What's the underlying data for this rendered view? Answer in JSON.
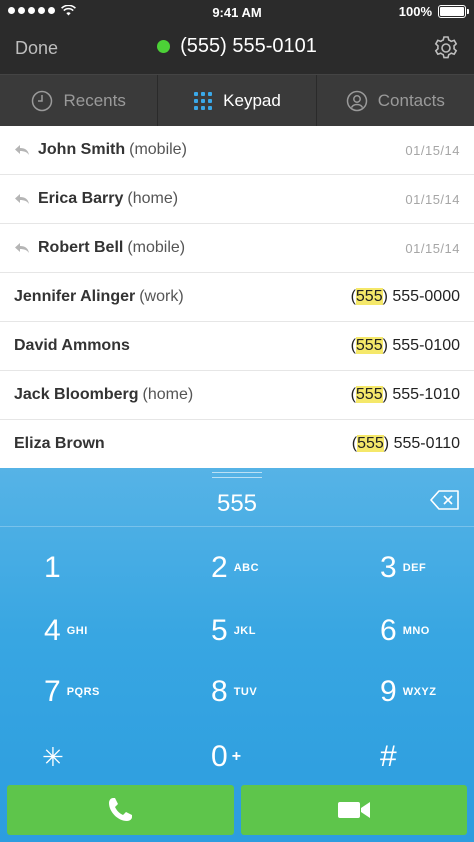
{
  "status": {
    "carrier_icon": "signal-dots",
    "time": "9:41 AM",
    "battery": "100%"
  },
  "nav": {
    "done_label": "Done",
    "call_number": "(555) 555-0101",
    "active_dot_color": "#4cd137"
  },
  "tabs": [
    {
      "label": "Recents",
      "icon": "clock-icon"
    },
    {
      "label": "Keypad",
      "icon": "keypad-grid-icon",
      "active": true
    },
    {
      "label": "Contacts",
      "icon": "person-icon"
    }
  ],
  "recents": [
    {
      "name": "John Smith",
      "type": "(mobile)",
      "date": "01/15/14"
    },
    {
      "name": "Erica Barry",
      "type": "(home)",
      "date": "01/15/14"
    },
    {
      "name": "Robert Bell",
      "type": "(mobile)",
      "date": "01/15/14"
    }
  ],
  "contacts": [
    {
      "name": "Jennifer Alinger",
      "type": "(work)",
      "prefix": "(",
      "match": "555",
      "rest": ") 555-0000"
    },
    {
      "name": "David Ammons",
      "type": "",
      "prefix": "(",
      "match": "555",
      "rest": ") 555-0100"
    },
    {
      "name": "Jack Bloomberg",
      "type": "(home)",
      "prefix": "(",
      "match": "555",
      "rest": ") 555-1010"
    },
    {
      "name": "Eliza Brown",
      "type": "",
      "prefix": "(",
      "match": "555",
      "rest": ") 555-0110"
    }
  ],
  "keypad": {
    "entered": "555",
    "keys": [
      {
        "digit": "1",
        "letters": ""
      },
      {
        "digit": "2",
        "letters": "ABC"
      },
      {
        "digit": "3",
        "letters": "DEF"
      },
      {
        "digit": "4",
        "letters": "GHI"
      },
      {
        "digit": "5",
        "letters": "JKL"
      },
      {
        "digit": "6",
        "letters": "MNO"
      },
      {
        "digit": "7",
        "letters": "PQRS"
      },
      {
        "digit": "8",
        "letters": "TUV"
      },
      {
        "digit": "9",
        "letters": "WXYZ"
      },
      {
        "digit": "✳",
        "letters": ""
      },
      {
        "digit": "0",
        "letters": "+"
      },
      {
        "digit": "#",
        "letters": ""
      }
    ]
  },
  "actions": {
    "call_icon": "phone-icon",
    "video_icon": "video-camera-icon",
    "button_color": "#5ec54b"
  }
}
